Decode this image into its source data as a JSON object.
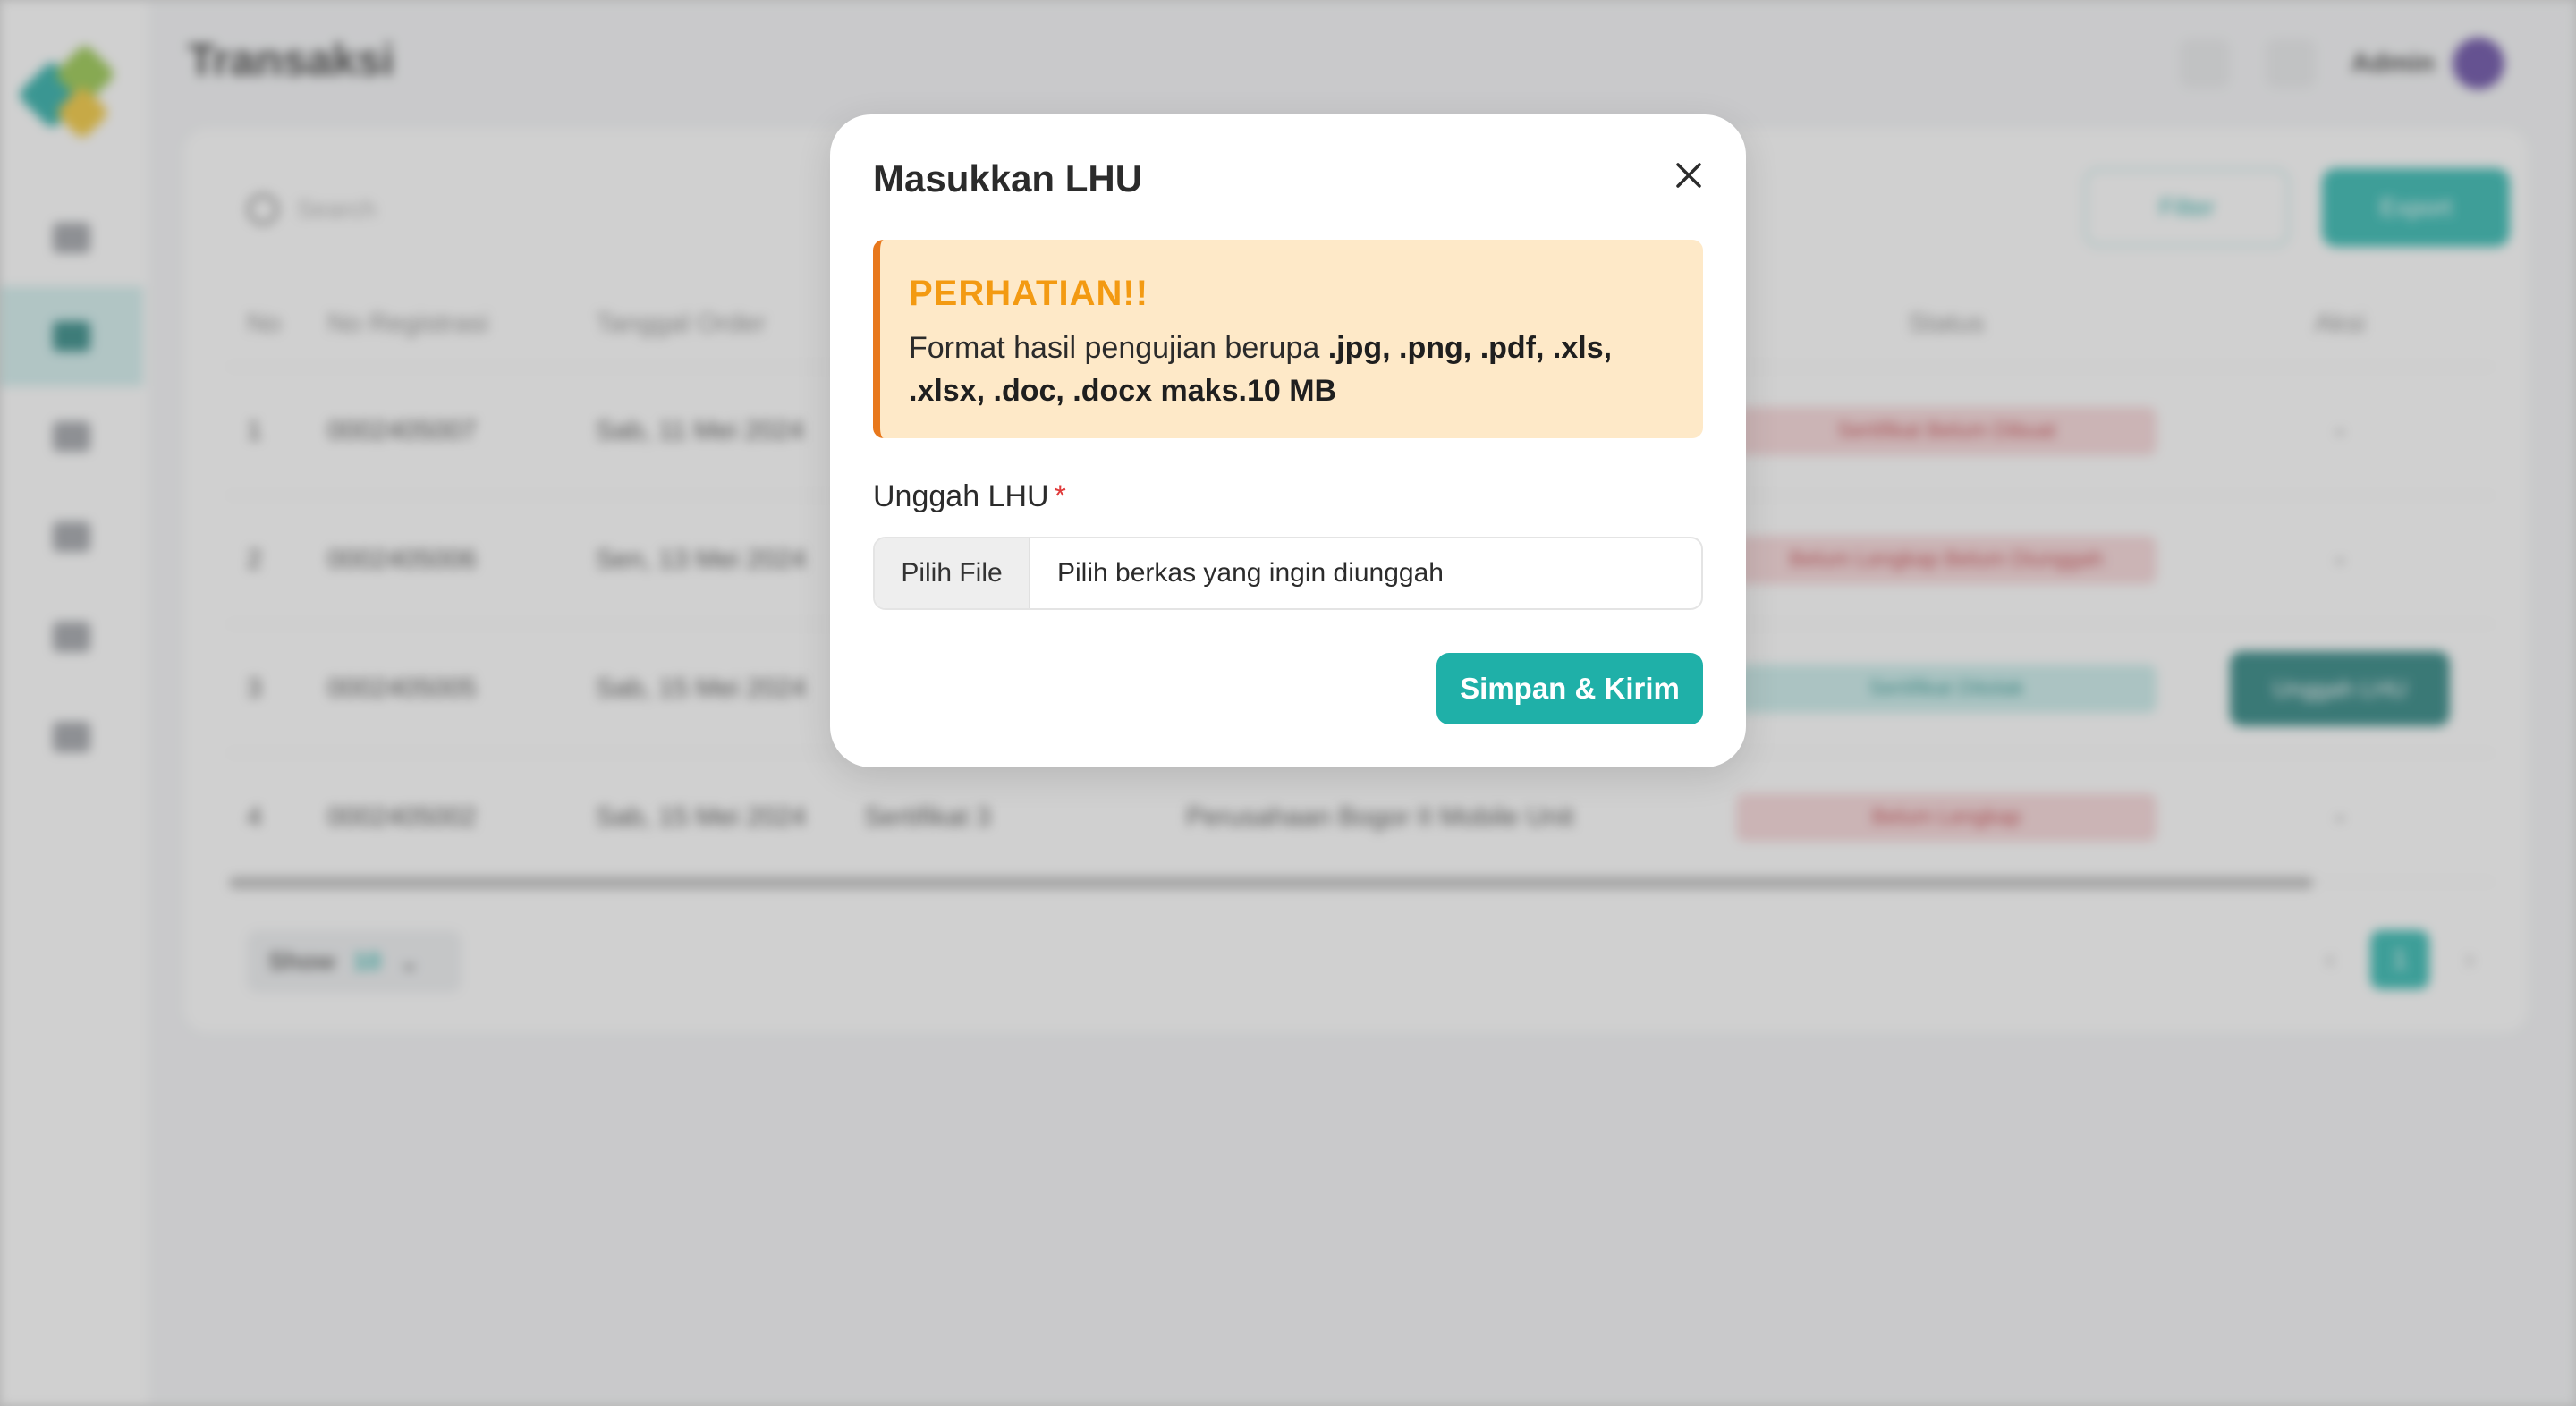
{
  "background": {
    "page_title": "Transaksi",
    "user_name": "Admin",
    "search_placeholder": "Search",
    "filter_label": "Filter",
    "export_label": "Export",
    "table": {
      "headers": [
        "No",
        "No Registrasi",
        "Tanggal Order",
        "",
        "",
        "Status",
        "Aksi"
      ],
      "rows": [
        {
          "no": "1",
          "reg": "0002405007",
          "date": "Sab, 11 Mei 2024",
          "col4": "",
          "col5": "",
          "status": "Sertifikat Belum Dibuat",
          "status_color": "red",
          "action": "-"
        },
        {
          "no": "2",
          "reg": "0002405006",
          "date": "Sen, 13 Mei 2024",
          "col4": "",
          "col5": "",
          "status": "Belum Lengkap Belum Diunggah",
          "status_color": "red",
          "action": "-"
        },
        {
          "no": "3",
          "reg": "0002405005",
          "date": "Sab, 15 Mei 2024",
          "col4": "",
          "col5": "",
          "status": "Sertifikat Ditolak",
          "status_color": "teal",
          "action": "Unggah LHU"
        },
        {
          "no": "4",
          "reg": "0002405002",
          "date": "Sab, 15 Mei 2024",
          "col4": "Sertifikat 3",
          "col5": "Perusahaan Bogor II Mobile Unit",
          "status": "Belum Lengkap",
          "status_color": "red",
          "action": "-"
        }
      ]
    },
    "show_label": "Show",
    "show_value": "10",
    "current_page": "1"
  },
  "modal": {
    "title": "Masukkan LHU",
    "alert": {
      "title": "PERHATIAN!!",
      "text_prefix": "Format hasil pengujian berupa ",
      "text_bold": ".jpg, .png, .pdf, .xls, .xlsx, .doc, .docx maks.10 MB"
    },
    "field_label": "Unggah LHU",
    "required_mark": "*",
    "file_button": "Pilih File",
    "file_placeholder": "Pilih berkas yang ingin diunggah",
    "submit_label": "Simpan & Kirim"
  },
  "colors": {
    "accent": "#1fb0a8",
    "alert_bg": "#fee9c8",
    "alert_border": "#e8781c",
    "alert_title": "#f39a12",
    "required": "#e03b3b"
  }
}
